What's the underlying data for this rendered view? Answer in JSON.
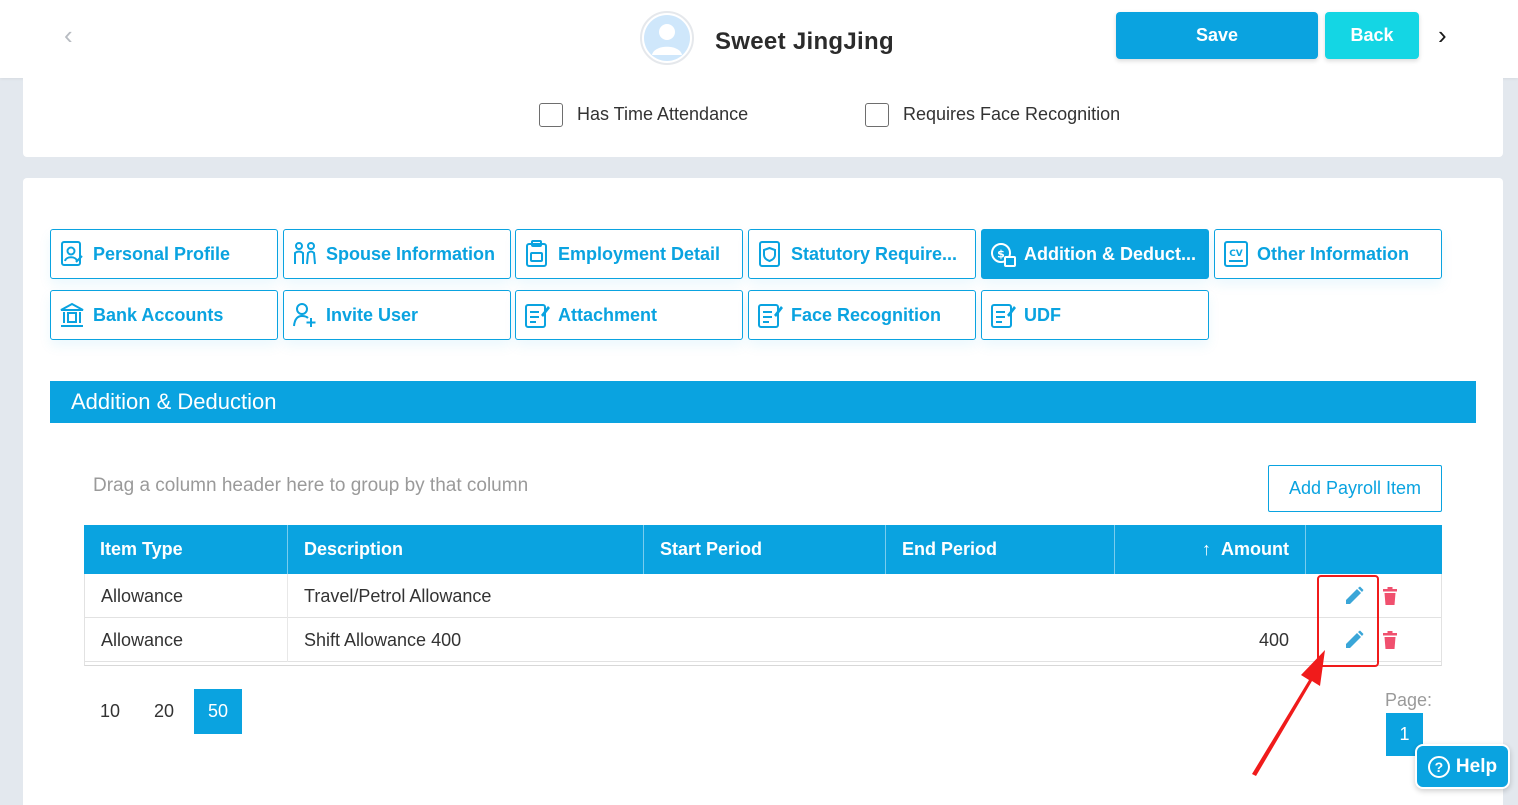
{
  "header": {
    "employee_name": "Sweet JingJing",
    "save_label": "Save",
    "back_label": "Back",
    "prev_glyph": "‹",
    "next_glyph": "›"
  },
  "options": {
    "time_attendance": {
      "label": "Has Time Attendance",
      "checked": false
    },
    "face_recognition": {
      "label": "Requires Face Recognition",
      "checked": false
    }
  },
  "tabs": [
    {
      "label": "Personal Profile",
      "icon": "profile-icon",
      "active": false
    },
    {
      "label": "Spouse Information",
      "icon": "couple-icon",
      "active": false
    },
    {
      "label": "Employment Detail",
      "icon": "clipboard-icon",
      "active": false
    },
    {
      "label": "Statutory Require...",
      "icon": "shield-document-icon",
      "active": false
    },
    {
      "label": "Addition & Deduct...",
      "icon": "money-icon",
      "active": true
    },
    {
      "label": "Other Information",
      "icon": "cv-icon",
      "active": false
    },
    {
      "label": "Bank Accounts",
      "icon": "bank-icon",
      "active": false
    },
    {
      "label": "Invite User",
      "icon": "add-user-icon",
      "active": false
    },
    {
      "label": "Attachment",
      "icon": "document-edit-icon",
      "active": false
    },
    {
      "label": "Face Recognition",
      "icon": "document-edit-icon",
      "active": false
    },
    {
      "label": "UDF",
      "icon": "document-edit-icon",
      "active": false
    }
  ],
  "section": {
    "title": "Addition & Deduction"
  },
  "grid": {
    "group_hint": "Drag a column header here to group by that column",
    "add_button": "Add Payroll Item",
    "columns": [
      "Item Type",
      "Description",
      "Start Period",
      "End Period",
      "Amount"
    ],
    "sort_glyph": "↑",
    "rows": [
      {
        "item_type": "Allowance",
        "description": "Travel/Petrol Allowance",
        "start_period": "",
        "end_period": "",
        "amount": ""
      },
      {
        "item_type": "Allowance",
        "description": "Shift Allowance 400",
        "start_period": "",
        "end_period": "",
        "amount": "400"
      }
    ]
  },
  "pager": {
    "sizes": [
      "10",
      "20",
      "50"
    ],
    "active_size": "50",
    "page_label": "Page:",
    "current_page": "1"
  },
  "help": {
    "label": "Help",
    "glyph": "?"
  },
  "colors": {
    "primary": "#0aa3e0",
    "back": "#14d6e4",
    "delete": "#f0506e",
    "edit": "#3aa6d8",
    "annotation": "#f01b1b"
  }
}
